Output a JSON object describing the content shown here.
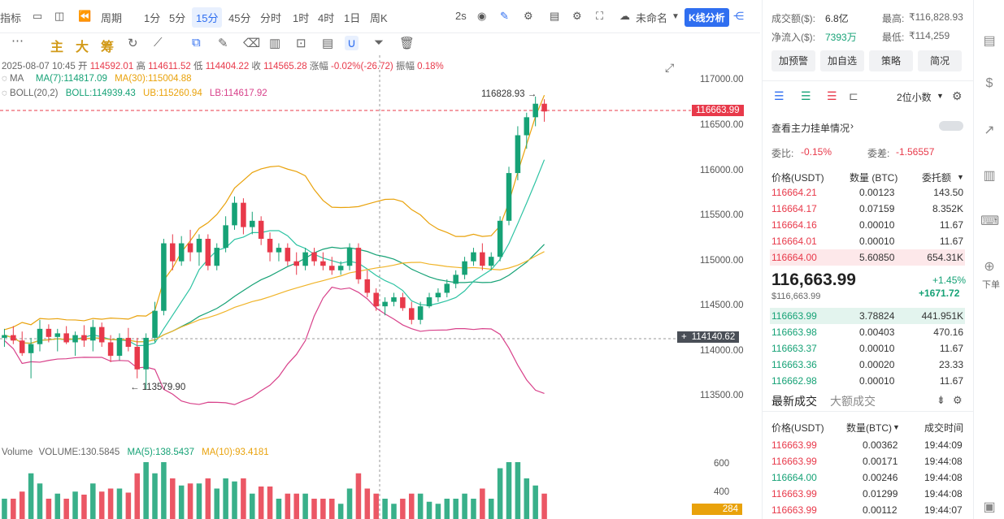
{
  "toolbar": {
    "indicators": "指标",
    "period": "周期",
    "intervals": [
      "1分",
      "5分",
      "15分",
      "45分",
      "分时",
      "1时",
      "4时",
      "1日",
      "周K"
    ],
    "active_interval": "15分",
    "refresh": "2s",
    "layout_name": "未命名",
    "kline_analysis": "K线分析"
  },
  "drawbar": {
    "tools": [
      "主",
      "大",
      "筹"
    ]
  },
  "ohlc": {
    "date": "2025-08-07 10:45",
    "open_label": "开",
    "open": "114592.01",
    "high_label": "高",
    "high": "114611.52",
    "low_label": "低",
    "low": "114404.22",
    "close_label": "收",
    "close": "114565.28",
    "change_label": "涨幅",
    "change": "-0.02%(-26.72)",
    "amplitude_label": "振幅",
    "amplitude": "0.18%"
  },
  "ma": {
    "label": "MA",
    "ma7": "MA(7):114817.09",
    "ma30": "MA(30):115004.88"
  },
  "boll": {
    "label": "BOLL(20,2)",
    "boll": "BOLL:114939.43",
    "ub": "UB:115260.94",
    "lb": "LB:114617.92"
  },
  "price_axis": {
    "ticks": [
      "117000.00",
      "116500.00",
      "116000.00",
      "115500.00",
      "115000.00",
      "114500.00",
      "114000.00",
      "113500.00"
    ],
    "last_price_tag": "116663.99",
    "crosshair_tag": "114140.62",
    "high_mark": "116828.93",
    "low_mark": "113579.90"
  },
  "volume": {
    "label": "Volume",
    "volume": "VOLUME:130.5845",
    "ma5": "MA(5):138.5437",
    "ma10": "MA(10):93.4181",
    "ticks": [
      "600",
      "400"
    ],
    "last_tag": "284"
  },
  "colors": {
    "up": "#16a276",
    "down": "#e8394a",
    "accent": "#2f6ef0",
    "ma30": "#e9a20b",
    "lb": "#d8418a"
  },
  "chart_data": {
    "type": "candlestick",
    "interval": "15分",
    "ylim": [
      113200,
      117200
    ],
    "candles": [
      [
        114150,
        114250,
        114050,
        114180
      ],
      [
        114180,
        114280,
        114080,
        114120
      ],
      [
        114120,
        114220,
        113950,
        113980
      ],
      [
        113980,
        114150,
        113700,
        114080
      ],
      [
        114080,
        114350,
        114000,
        114250
      ],
      [
        114250,
        114300,
        114100,
        114160
      ],
      [
        114160,
        114250,
        114000,
        114200
      ],
      [
        114200,
        114280,
        114080,
        114100
      ],
      [
        114100,
        114220,
        113950,
        114180
      ],
      [
        114180,
        114290,
        114050,
        114120
      ],
      [
        114120,
        114350,
        114000,
        114270
      ],
      [
        114270,
        114320,
        114050,
        114100
      ],
      [
        114100,
        114180,
        113880,
        113950
      ],
      [
        113950,
        114200,
        113900,
        114150
      ],
      [
        114150,
        114260,
        114000,
        114050
      ],
      [
        114050,
        114150,
        113700,
        113800
      ],
      [
        113800,
        114200,
        113580,
        114150
      ],
      [
        114150,
        114550,
        114100,
        114450
      ],
      [
        114450,
        115250,
        114400,
        115200
      ],
      [
        115200,
        115300,
        114900,
        115000
      ],
      [
        115000,
        115280,
        114950,
        115200
      ],
      [
        115200,
        115350,
        115000,
        115100
      ],
      [
        115100,
        115300,
        114950,
        115250
      ],
      [
        115250,
        115300,
        114900,
        114950
      ],
      [
        114950,
        115200,
        114900,
        115150
      ],
      [
        115150,
        115500,
        115100,
        115400
      ],
      [
        115400,
        115720,
        115350,
        115650
      ],
      [
        115650,
        115700,
        115300,
        115380
      ],
      [
        115380,
        115550,
        115300,
        115450
      ],
      [
        115450,
        115500,
        115180,
        115250
      ],
      [
        115250,
        115320,
        115000,
        115100
      ],
      [
        115100,
        115200,
        115000,
        115150
      ],
      [
        115150,
        115200,
        114950,
        115000
      ],
      [
        115000,
        115100,
        114850,
        114950
      ],
      [
        114950,
        115150,
        114900,
        115100
      ],
      [
        115100,
        115150,
        114950,
        115000
      ],
      [
        115000,
        115100,
        114900,
        114950
      ],
      [
        114950,
        115050,
        114850,
        114900
      ],
      [
        114900,
        115000,
        114850,
        114950
      ],
      [
        114950,
        115200,
        114900,
        115150
      ],
      [
        115150,
        115200,
        114750,
        114800
      ],
      [
        114800,
        114900,
        114600,
        114650
      ],
      [
        114650,
        114700,
        114450,
        114500
      ],
      [
        114500,
        114600,
        114400,
        114550
      ],
      [
        114550,
        114650,
        114500,
        114600
      ],
      [
        114600,
        114650,
        114450,
        114480
      ],
      [
        114480,
        114550,
        114300,
        114350
      ],
      [
        114350,
        114550,
        114300,
        114500
      ],
      [
        114500,
        114650,
        114480,
        114600
      ],
      [
        114600,
        114700,
        114550,
        114650
      ],
      [
        114650,
        114800,
        114600,
        114750
      ],
      [
        114750,
        114900,
        114700,
        114850
      ],
      [
        114850,
        115050,
        114800,
        115000
      ],
      [
        115000,
        115150,
        114950,
        115100
      ],
      [
        115100,
        115200,
        114900,
        114950
      ],
      [
        114950,
        115100,
        114900,
        115050
      ],
      [
        115050,
        115500,
        115000,
        115450
      ],
      [
        115450,
        116050,
        115400,
        115980
      ],
      [
        115980,
        116500,
        115900,
        116400
      ],
      [
        116400,
        116650,
        116250,
        116600
      ],
      [
        116600,
        116830,
        116500,
        116750
      ],
      [
        116750,
        116800,
        116550,
        116664
      ]
    ]
  },
  "right_panel": {
    "turnover_label": "成交额($):",
    "turnover": "6.8亿",
    "high_label": "最高:",
    "high": "₹116,828.93",
    "inflow_label": "净流入($):",
    "inflow": "7393万",
    "low_label": "最低:",
    "low": "₹114,259",
    "buttons": [
      "加预警",
      "加自选",
      "策略",
      "简况"
    ],
    "decimals": "2位小数",
    "main_orders": "查看主力挂单情况",
    "ratio_label": "委比:",
    "ratio": "-0.15%",
    "diff_label": "委差:",
    "diff": "-1.56557",
    "ob_headers": [
      "价格(USDT)",
      "数量 (BTC)",
      "委托额"
    ],
    "asks": [
      [
        "116664.21",
        "0.00123",
        "143.50"
      ],
      [
        "116664.17",
        "0.07159",
        "8.352K"
      ],
      [
        "116664.16",
        "0.00010",
        "11.67"
      ],
      [
        "116664.01",
        "0.00010",
        "11.67"
      ],
      [
        "116664.00",
        "5.60850",
        "654.31K"
      ]
    ],
    "last_price": "116,663.99",
    "last_price_sub": "$116,663.99",
    "pct_change": "+1.45%",
    "abs_change": "+1671.72",
    "bids": [
      [
        "116663.99",
        "3.78824",
        "441.951K"
      ],
      [
        "116663.98",
        "0.00403",
        "470.16"
      ],
      [
        "116663.37",
        "0.00010",
        "11.67"
      ],
      [
        "116663.36",
        "0.00020",
        "23.33"
      ],
      [
        "116662.98",
        "0.00010",
        "11.67"
      ]
    ],
    "trade_tabs": [
      "最新成交",
      "大额成交"
    ],
    "trade_headers": [
      "价格(USDT)",
      "数量(BTC)",
      "成交时间"
    ],
    "trades": [
      [
        "116663.99",
        "0.00362",
        "19:44:09",
        "down"
      ],
      [
        "116663.99",
        "0.00171",
        "19:44:08",
        "down"
      ],
      [
        "116664.00",
        "0.00246",
        "19:44:08",
        "up"
      ],
      [
        "116663.99",
        "0.01299",
        "19:44:08",
        "down"
      ],
      [
        "116663.99",
        "0.00112",
        "19:44:07",
        "down"
      ]
    ]
  },
  "side_toolbar": {
    "order_label": "下单"
  }
}
